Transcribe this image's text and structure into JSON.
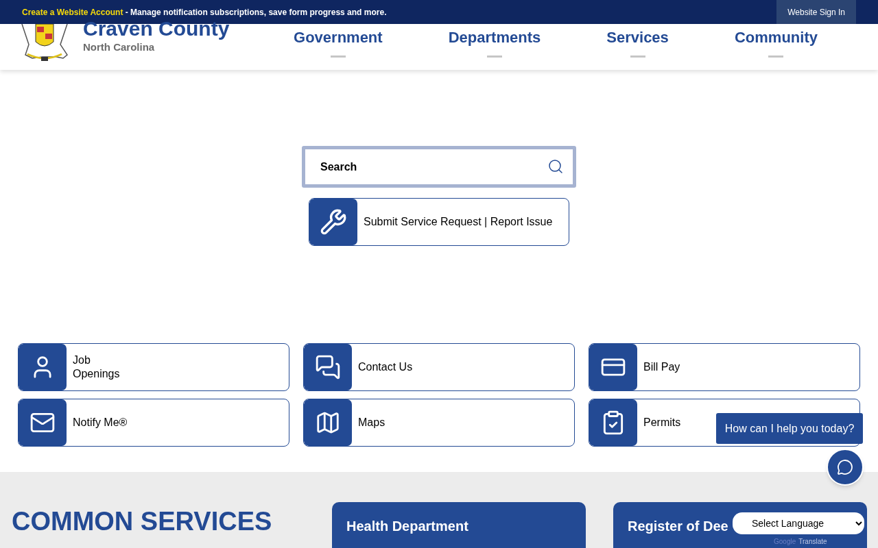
{
  "top_bar": {
    "link": "Create a Website Account",
    "message": "- Manage notification subscriptions, save form progress and more.",
    "sign_in": "Website Sign In"
  },
  "header": {
    "title": "Craven County",
    "subtitle": "North Carolina",
    "nav": [
      "Government",
      "Departments",
      "Services",
      "Community"
    ]
  },
  "search": {
    "placeholder": "Search"
  },
  "service_request": {
    "label": "Submit Service Request | Report Issue"
  },
  "quick_links": [
    {
      "kind": "person",
      "label": "Job\nOpenings"
    },
    {
      "kind": "chat",
      "label": "Contact Us"
    },
    {
      "kind": "card",
      "label": "Bill Pay"
    },
    {
      "kind": "mail",
      "label": "Notify Me®"
    },
    {
      "kind": "map",
      "label": "Maps"
    },
    {
      "kind": "clipboard",
      "label": "Permits"
    }
  ],
  "common_services": {
    "heading": "COMMON SERVICES",
    "cards": [
      "Health Department",
      "Register of Dee"
    ]
  },
  "chat": {
    "prompt": "How can I help you today?"
  },
  "translate": {
    "select": "Select Language",
    "brand": "Google",
    "label": "Translate"
  }
}
